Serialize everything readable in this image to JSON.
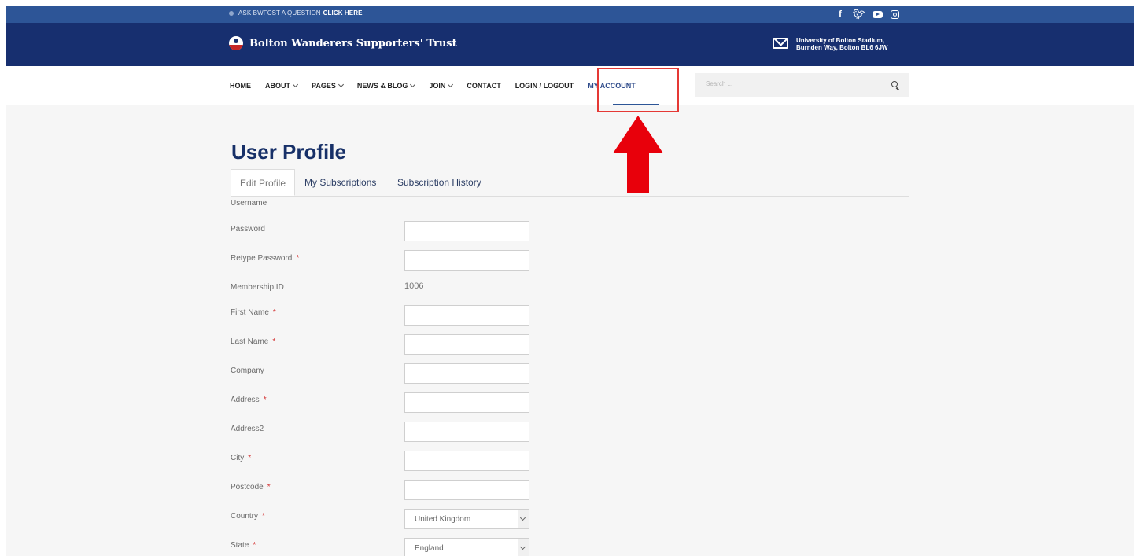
{
  "topbar": {
    "ask_text": "ASK BWFCST A QUESTION",
    "ask_link": "CLICK HERE",
    "social": [
      "facebook-icon",
      "twitter-icon",
      "youtube-icon",
      "instagram-icon"
    ]
  },
  "header": {
    "brand": "Bolton Wanderers Supporters' Trust",
    "address_line1": "University of Bolton Stadium,",
    "address_line2": "Burnden Way, Bolton BL6 6JW"
  },
  "nav": {
    "items": [
      {
        "label": "HOME",
        "dropdown": false
      },
      {
        "label": "ABOUT",
        "dropdown": true
      },
      {
        "label": "PAGES",
        "dropdown": true
      },
      {
        "label": "NEWS & BLOG",
        "dropdown": true
      },
      {
        "label": "JOIN",
        "dropdown": true
      },
      {
        "label": "CONTACT",
        "dropdown": false
      },
      {
        "label": "LOGIN / LOGOUT",
        "dropdown": false
      },
      {
        "label": "MY ACCOUNT",
        "dropdown": false,
        "active": true
      }
    ],
    "search_placeholder": "Search ..."
  },
  "page": {
    "title": "User Profile",
    "tabs": [
      "Edit Profile",
      "My Subscriptions",
      "Subscription History"
    ],
    "fields": {
      "username": "Username",
      "password": "Password",
      "retype_password": "Retype Password",
      "membership_id": "Membership ID",
      "membership_id_value": "1006",
      "first_name": "First Name",
      "last_name": "Last Name",
      "company": "Company",
      "address": "Address",
      "address2": "Address2",
      "city": "City",
      "postcode": "Postcode",
      "country": "Country",
      "country_value": "United Kingdom",
      "state": "State",
      "state_value": "England"
    },
    "required_mark": "*"
  },
  "colors": {
    "topbar": "#2d5597",
    "header": "#172f6f",
    "highlight": "#e53935",
    "arrow": "#e8000b"
  }
}
